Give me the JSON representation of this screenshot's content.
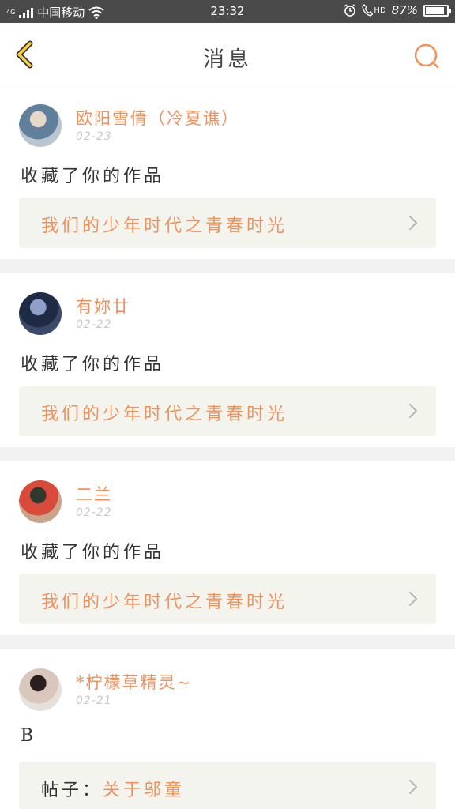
{
  "status_bar": {
    "network_small": "4G",
    "carrier": "中国移动",
    "time": "23:32",
    "volte": "HD",
    "battery_percent_text": "87%",
    "battery_level": 0.87
  },
  "nav": {
    "title": "消息",
    "accent_color": "#f0905a"
  },
  "messages": [
    {
      "username": "欧阳雪倩（冷夏谯）",
      "date": "02-23",
      "action": "收藏了你的作品",
      "link_prefix": "",
      "link_title": "我们的少年时代之青春时光",
      "avatar_colors": [
        "#b9c6cf",
        "#e8d8c8",
        "#5f7f9a"
      ]
    },
    {
      "username": "有妳廿",
      "date": "02-22",
      "action": "收藏了你的作品",
      "link_prefix": "",
      "link_title": "我们的少年时代之青春时光",
      "avatar_colors": [
        "#3b4a6b",
        "#8fa0c8",
        "#1f2a44"
      ]
    },
    {
      "username": "二兰",
      "date": "02-22",
      "action": "收藏了你的作品",
      "link_prefix": "",
      "link_title": "我们的少年时代之青春时光",
      "avatar_colors": [
        "#c9a38a",
        "#2d3a2d",
        "#d84a3a"
      ]
    },
    {
      "username": "*柠檬草精灵~",
      "date": "02-21",
      "action": "B",
      "link_prefix": "帖子：",
      "link_title": "关于邬童",
      "avatar_colors": [
        "#e6e0dc",
        "#2a2020",
        "#d9c6bc"
      ]
    }
  ]
}
